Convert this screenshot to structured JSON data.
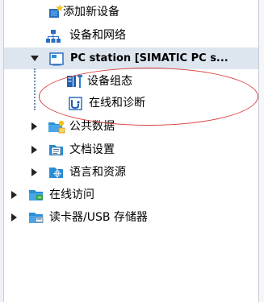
{
  "tree": {
    "items": [
      {
        "id": "add-device",
        "label": "添加新设备",
        "icon": "add-device-icon",
        "expander": "none",
        "level": 2
      },
      {
        "id": "devices-networks",
        "label": "设备和网络",
        "icon": "network-icon",
        "expander": "none",
        "level": 2
      },
      {
        "id": "pc-station",
        "label": "PC station [SIMATIC PC s...",
        "icon": "pc-station-icon",
        "expander": "expanded",
        "level": 2
      },
      {
        "id": "device-config",
        "label": "设备组态",
        "icon": "device-config-icon",
        "expander": "none",
        "level": 3
      },
      {
        "id": "online-diagnostics",
        "label": "在线和诊断",
        "icon": "diagnostics-icon",
        "expander": "none",
        "level": 3
      },
      {
        "id": "common-data",
        "label": "公共数据",
        "icon": "common-data-icon",
        "expander": "collapsed",
        "level": 2
      },
      {
        "id": "doc-settings",
        "label": "文档设置",
        "icon": "doc-settings-icon",
        "expander": "collapsed",
        "level": 2
      },
      {
        "id": "languages-resources",
        "label": "语言和资源",
        "icon": "languages-icon",
        "expander": "collapsed",
        "level": 2
      },
      {
        "id": "online-access",
        "label": "在线访问",
        "icon": "online-access-icon",
        "expander": "collapsed",
        "level": 1
      },
      {
        "id": "card-reader",
        "label": "读卡器/USB 存储器",
        "icon": "card-reader-icon",
        "expander": "collapsed",
        "level": 1
      }
    ]
  },
  "colors": {
    "selection": "#dde5ee",
    "annotation": "#d83a3a",
    "folder": "#2a8fd6",
    "tree_line": "#6a8ab0"
  }
}
